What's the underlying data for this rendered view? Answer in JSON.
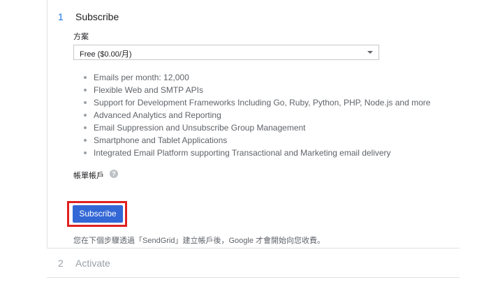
{
  "step1": {
    "number": "1",
    "title": "Subscribe"
  },
  "plan": {
    "label": "方案",
    "selected": "Free ($0.00/月)"
  },
  "features": [
    "Emails per month: 12,000",
    "Flexible Web and SMTP APIs",
    "Support for Development Frameworks Including Go, Ruby, Python, PHP, Node.js and more",
    "Advanced Analytics and Reporting",
    "Email Suppression and Unsubscribe Group Management",
    "Smartphone and Tablet Applications",
    "Integrated Email Platform supporting Transactional and Marketing email delivery"
  ],
  "billing": {
    "label": "帳單帳戶",
    "help_icon": "?"
  },
  "subscribe_button": "Subscribe",
  "note": "您在下個步驟透過「SendGrid」建立帳戶後，Google 才會開始向您收費。",
  "step2": {
    "number": "2",
    "title": "Activate"
  },
  "colors": {
    "accent": "#3367d6",
    "highlight": "#e02020",
    "step_active": "#1a73e8",
    "step_inactive": "#9aa0a6"
  }
}
